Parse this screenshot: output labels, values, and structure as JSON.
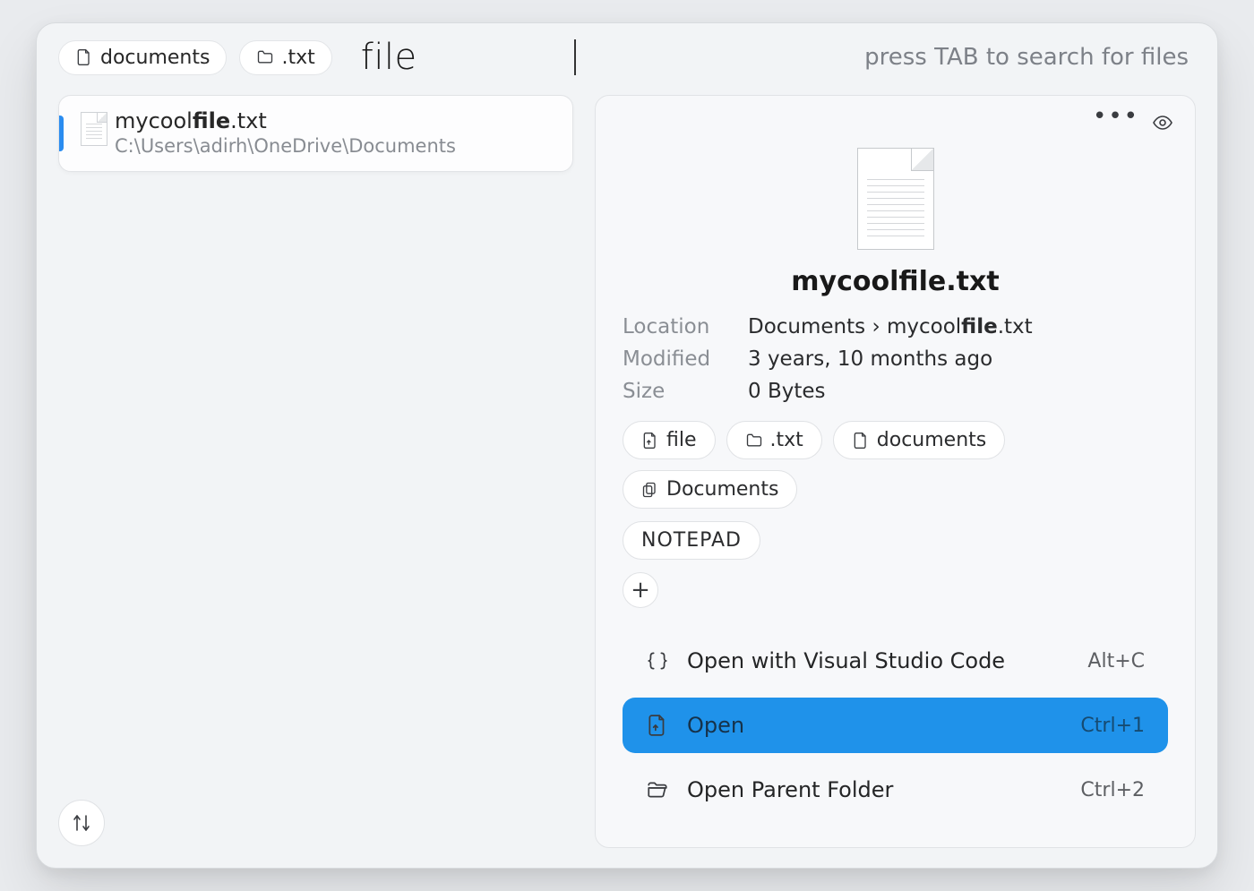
{
  "search": {
    "filters": [
      {
        "label": "documents",
        "icon": "document-icon"
      },
      {
        "label": ".txt",
        "icon": "folder-icon"
      }
    ],
    "query": "file",
    "hint": "press TAB to search for files"
  },
  "results": [
    {
      "title_plain": "mycool",
      "title_bold": "file",
      "title_ext": ".txt",
      "path": "C:\\Users\\adirh\\OneDrive\\Documents"
    }
  ],
  "preview": {
    "title": "mycoolfile.txt",
    "meta": {
      "location_label": "Location",
      "location_value_pre": "Documents › mycool",
      "location_value_bold": "file",
      "location_value_post": ".txt",
      "modified_label": "Modified",
      "modified_value": "3 years, 10 months ago",
      "size_label": "Size",
      "size_value": "0 Bytes"
    },
    "tags": [
      {
        "label": "file",
        "icon": "file-up-icon"
      },
      {
        "label": ".txt",
        "icon": "folder-icon"
      },
      {
        "label": "documents",
        "icon": "document-icon"
      },
      {
        "label": "Documents",
        "icon": "duplicate-icon"
      },
      {
        "label": "NOTEPAD",
        "icon": null,
        "notepad": true
      }
    ],
    "add_tag_label": "+",
    "actions": [
      {
        "label": "Open with Visual Studio Code",
        "shortcut": "Alt+C",
        "icon": "braces-icon",
        "selected": false
      },
      {
        "label": "Open",
        "shortcut": "Ctrl+1",
        "icon": "file-up-icon",
        "selected": true
      },
      {
        "label": "Open Parent Folder",
        "shortcut": "Ctrl+2",
        "icon": "folder-open-icon",
        "selected": false
      }
    ]
  }
}
